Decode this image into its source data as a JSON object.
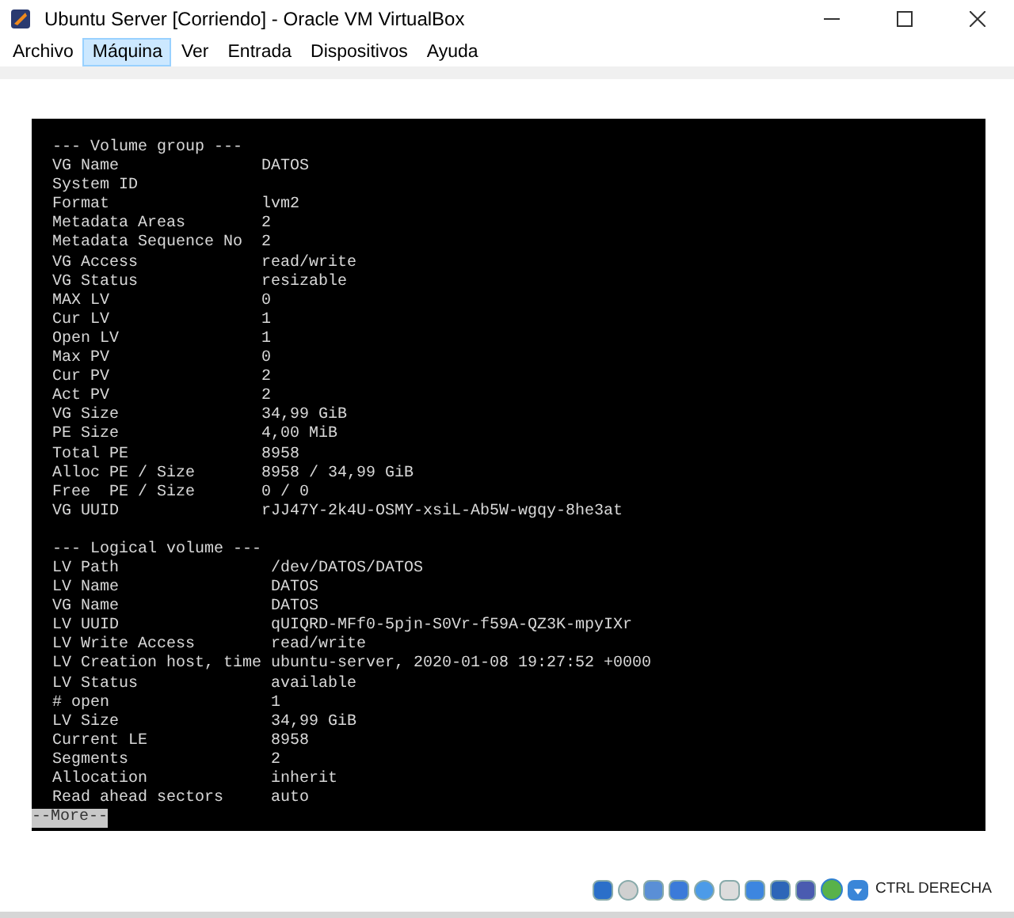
{
  "window": {
    "title": "Ubuntu Server [Corriendo] - Oracle VM VirtualBox"
  },
  "menu": [
    {
      "label": "Archivo",
      "selected": false
    },
    {
      "label": "Máquina",
      "selected": true
    },
    {
      "label": "Ver",
      "selected": false
    },
    {
      "label": "Entrada",
      "selected": false
    },
    {
      "label": "Dispositivos",
      "selected": false
    },
    {
      "label": "Ayuda",
      "selected": false
    }
  ],
  "console": {
    "sections": [
      {
        "header": "--- Volume group ---",
        "rows": [
          {
            "label": "VG Name",
            "value": "DATOS"
          },
          {
            "label": "System ID"
          },
          {
            "label": "Format",
            "value": "lvm2"
          },
          {
            "label": "Metadata Areas",
            "value": "2"
          },
          {
            "label": "Metadata Sequence No",
            "value": "2"
          },
          {
            "label": "VG Access",
            "value": "read/write"
          },
          {
            "label": "VG Status",
            "value": "resizable"
          },
          {
            "label": "MAX LV",
            "value": "0"
          },
          {
            "label": "Cur LV",
            "value": "1"
          },
          {
            "label": "Open LV",
            "value": "1"
          },
          {
            "label": "Max PV",
            "value": "0"
          },
          {
            "label": "Cur PV",
            "value": "2"
          },
          {
            "label": "Act PV",
            "value": "2"
          },
          {
            "label": "VG Size",
            "value": "34,99 GiB"
          },
          {
            "label": "PE Size",
            "value": "4,00 MiB"
          },
          {
            "label": "Total PE",
            "value": "8958"
          },
          {
            "label": "Alloc PE / Size",
            "value": "8958 / 34,99 GiB"
          },
          {
            "label": "Free  PE / Size",
            "value": "0 / 0"
          },
          {
            "label": "VG UUID",
            "value": "rJJ47Y-2k4U-OSMY-xsiL-Ab5W-wgqy-8he3at"
          }
        ]
      },
      {
        "header": "--- Logical volume ---",
        "rows": [
          {
            "label": "LV Path",
            "value": "/dev/DATOS/DATOS"
          },
          {
            "label": "LV Name",
            "value": "DATOS"
          },
          {
            "label": "VG Name",
            "value": "DATOS"
          },
          {
            "label": "LV UUID",
            "value": "qUIQRD-MFf0-5pjn-S0Vr-f59A-QZ3K-mpyIXr"
          },
          {
            "label": "LV Write Access",
            "value": "read/write"
          },
          {
            "label": "LV Creation host, time",
            "value": "ubuntu-server, 2020-01-08 19:27:52 +0000"
          },
          {
            "label": "LV Status",
            "value": "available"
          },
          {
            "label": "# open",
            "value": "1"
          },
          {
            "label": "LV Size",
            "value": "34,99 GiB"
          },
          {
            "label": "Current LE",
            "value": "8958"
          },
          {
            "label": "Segments",
            "value": "2"
          },
          {
            "label": "Allocation",
            "value": "inherit"
          },
          {
            "label": "Read ahead sectors",
            "value": "auto"
          }
        ]
      }
    ],
    "pager": "--More--"
  },
  "status_bar": {
    "host_key": "CTRL DERECHA"
  }
}
